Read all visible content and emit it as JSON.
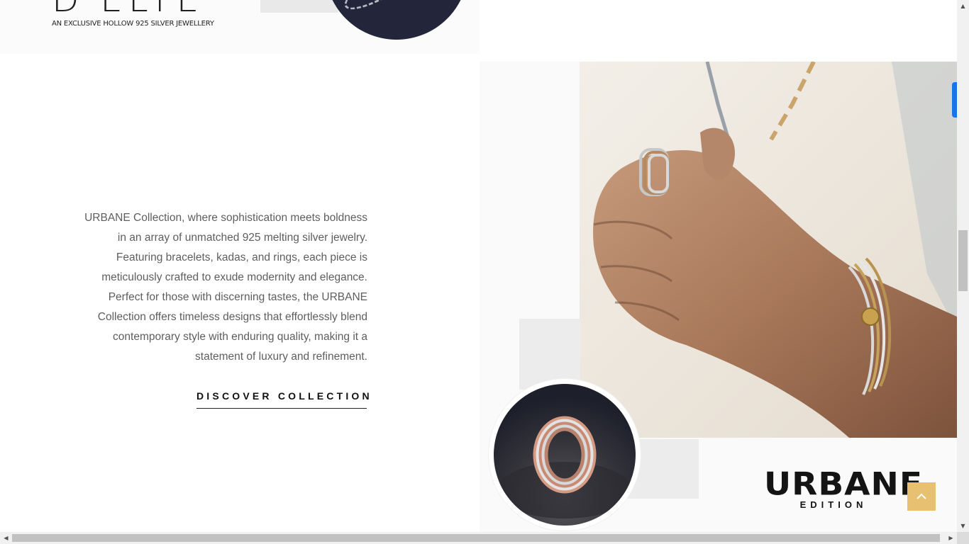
{
  "previous_section": {
    "brand_partial": "D'ELYE",
    "tagline": "AN EXCLUSIVE HOLLOW 925 SILVER JEWELLERY"
  },
  "urbane_section": {
    "description": "URBANE Collection, where sophistication meets boldness in an array of unmatched 925 melting silver jewelry. Featuring bracelets, kadas, and rings, each piece is meticulously crafted to exude modernity and elegance. Perfect for those with discerning tastes, the URBANE Collection offers timeless designs that effortlessly blend contemporary style with enduring quality, making it a statement of luxury and refinement.",
    "cta_label": "DISCOVER COLLECTION",
    "logo_title": "URBANE",
    "logo_subtitle": "EDITION"
  },
  "icons": {
    "back_to_top": "chevron-up-icon",
    "scroll_up": "triangle-up-icon",
    "scroll_down": "triangle-down-icon",
    "scroll_left": "triangle-left-icon",
    "scroll_right": "triangle-right-icon"
  },
  "colors": {
    "accent_gold": "#e8c071",
    "side_tab_blue": "#1a73e8",
    "text_body": "#5e5e5e",
    "text_dark": "#111111"
  }
}
